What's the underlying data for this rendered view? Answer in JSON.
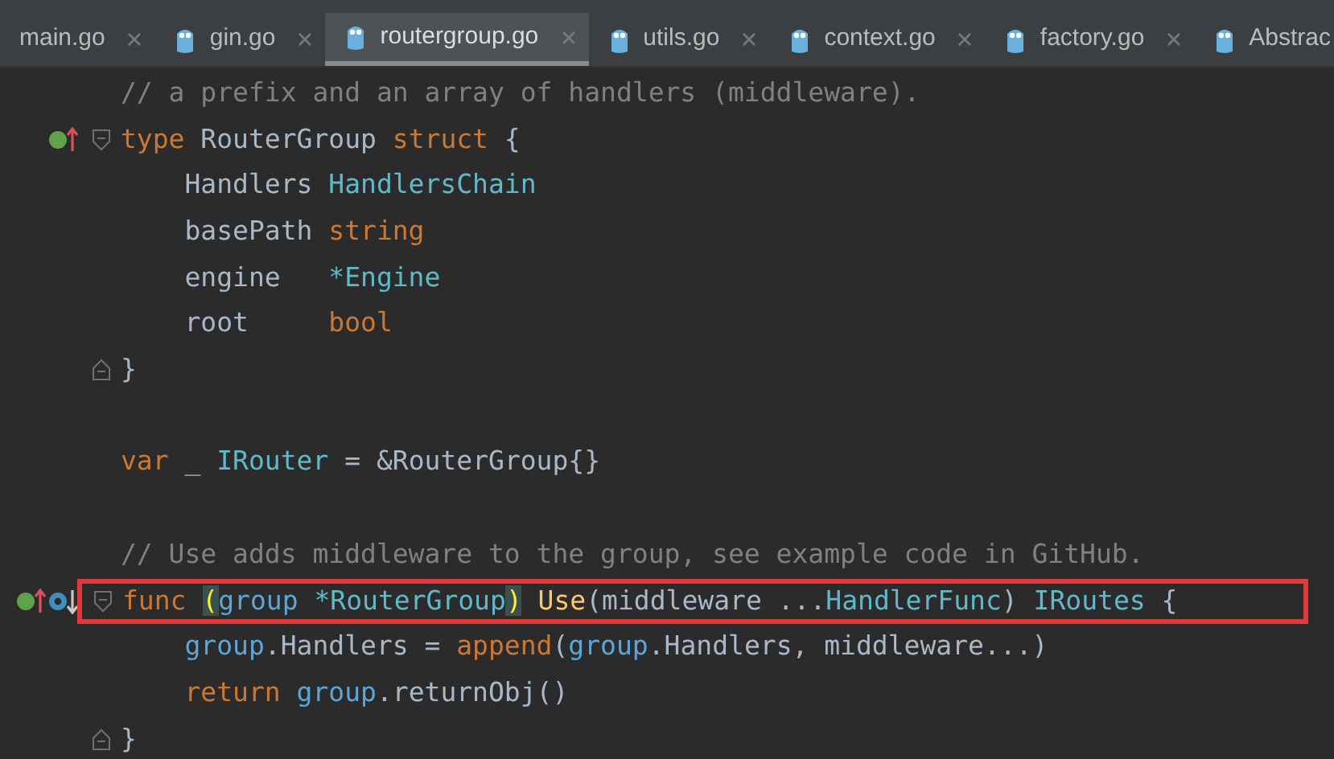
{
  "tabs": [
    {
      "label": "main.go",
      "selected": false,
      "icon": false
    },
    {
      "label": "gin.go",
      "selected": false,
      "icon": true
    },
    {
      "label": "routergroup.go",
      "selected": true,
      "icon": true
    },
    {
      "label": "utils.go",
      "selected": false,
      "icon": true
    },
    {
      "label": "context.go",
      "selected": false,
      "icon": true
    },
    {
      "label": "factory.go",
      "selected": false,
      "icon": true
    },
    {
      "label": "Abstrac",
      "selected": false,
      "icon": true
    }
  ],
  "lines": [
    {
      "kind": "code",
      "tokens": [
        {
          "kind": "comment",
          "text": "// a prefix and an array of handlers (middleware)."
        }
      ]
    },
    {
      "kind": "code",
      "fold_start": true,
      "implements_marker": true,
      "tokens": [
        {
          "kind": "keyword",
          "text": "type"
        },
        {
          "kind": "plain",
          "text": " RouterGroup "
        },
        {
          "kind": "keyword",
          "text": "struct"
        },
        {
          "kind": "plain",
          "text": " {"
        }
      ]
    },
    {
      "kind": "code",
      "tokens": [
        {
          "kind": "plain",
          "text": "    Handlers "
        },
        {
          "kind": "type",
          "text": "HandlersChain"
        }
      ]
    },
    {
      "kind": "code",
      "tokens": [
        {
          "kind": "plain",
          "text": "    basePath "
        },
        {
          "kind": "keyword",
          "text": "string"
        }
      ]
    },
    {
      "kind": "code",
      "tokens": [
        {
          "kind": "plain",
          "text": "    engine   "
        },
        {
          "kind": "type",
          "text": "*Engine"
        }
      ]
    },
    {
      "kind": "code",
      "tokens": [
        {
          "kind": "plain",
          "text": "    root     "
        },
        {
          "kind": "keyword",
          "text": "bool"
        }
      ]
    },
    {
      "kind": "code",
      "fold_end": true,
      "tokens": [
        {
          "kind": "plain",
          "text": "}"
        }
      ]
    },
    {
      "kind": "blank"
    },
    {
      "kind": "code",
      "tokens": [
        {
          "kind": "keyword",
          "text": "var"
        },
        {
          "kind": "plain",
          "text": " _ "
        },
        {
          "kind": "type",
          "text": "IRouter"
        },
        {
          "kind": "plain",
          "text": " = &RouterGroup{}"
        }
      ]
    },
    {
      "kind": "blank"
    },
    {
      "kind": "code",
      "tokens": [
        {
          "kind": "comment",
          "text": "// Use adds middleware to the group, see example code in GitHub."
        }
      ]
    },
    {
      "kind": "code",
      "fold_start": true,
      "highlighted": true,
      "implements_marker": true,
      "overrides_marker": true,
      "tokens": [
        {
          "kind": "keyword",
          "text": "func "
        },
        {
          "kind": "plain",
          "text": "(",
          "matched": true
        },
        {
          "kind": "param",
          "text": "group "
        },
        {
          "kind": "type",
          "text": "*RouterGroup"
        },
        {
          "kind": "plain",
          "text": ")",
          "matched": true
        },
        {
          "kind": "func",
          "text": " Use"
        },
        {
          "kind": "plain",
          "text": "(middleware ..."
        },
        {
          "kind": "type",
          "text": "HandlerFunc"
        },
        {
          "kind": "plain",
          "text": ") "
        },
        {
          "kind": "type",
          "text": "IRoutes"
        },
        {
          "kind": "plain",
          "text": " {"
        }
      ]
    },
    {
      "kind": "code",
      "tokens": [
        {
          "kind": "param",
          "text": "    group"
        },
        {
          "kind": "plain",
          "text": ".Handlers = "
        },
        {
          "kind": "keyword",
          "text": "append"
        },
        {
          "kind": "plain",
          "text": "("
        },
        {
          "kind": "param",
          "text": "group"
        },
        {
          "kind": "plain",
          "text": ".Handlers, middleware...)"
        }
      ]
    },
    {
      "kind": "code",
      "tokens": [
        {
          "kind": "keyword",
          "text": "    return "
        },
        {
          "kind": "param",
          "text": "group"
        },
        {
          "kind": "plain",
          "text": ".returnObj()"
        }
      ]
    },
    {
      "kind": "code",
      "fold_end": true,
      "tokens": [
        {
          "kind": "plain",
          "text": "}"
        }
      ]
    }
  ]
}
